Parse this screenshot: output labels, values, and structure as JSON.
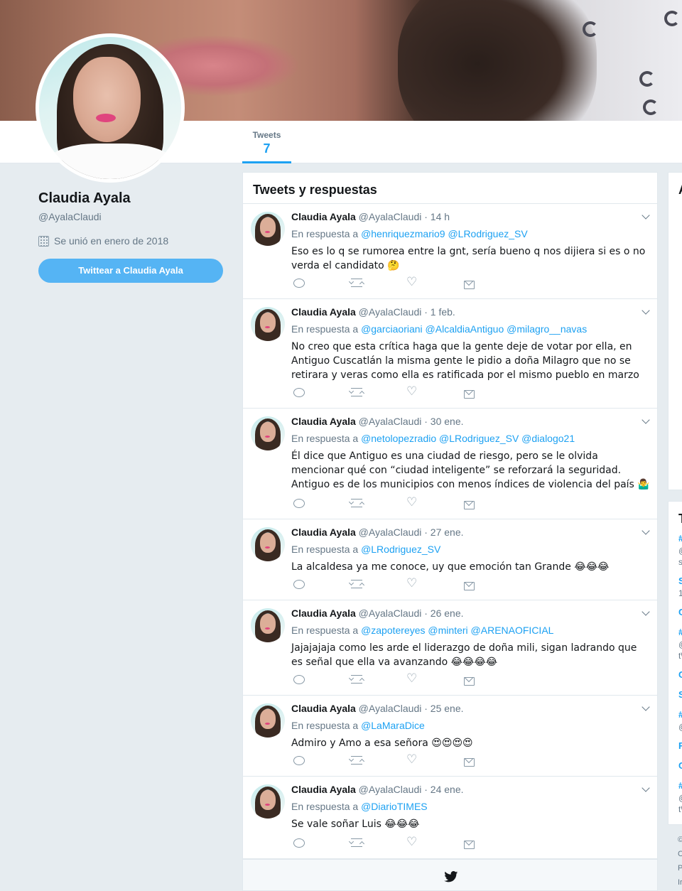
{
  "profile": {
    "name": "Claudia Ayala",
    "handle": "@AyalaClaudi",
    "joined": "Se unió en enero de 2018",
    "tweet_to_button": "Twittear a Claudia Ayala"
  },
  "nav": {
    "tweets_label": "Tweets",
    "tweets_count": "7"
  },
  "timeline": {
    "header": "Tweets y respuestas",
    "reply_prefix": "En respuesta a",
    "tweets": [
      {
        "name": "Claudia Ayala",
        "handle": "@AyalaClaudi",
        "time": "· 14 h",
        "mentions": "@henriquezmario9 @LRodriguez_SV",
        "text": "Eso es lo q se rumorea entre la gnt, sería bueno q nos dijiera si es o no verda el candidato 🤔"
      },
      {
        "name": "Claudia Ayala",
        "handle": "@AyalaClaudi",
        "time": "· 1 feb.",
        "mentions": "@garciaoriani @AlcaldiaAntiguo @milagro__navas",
        "text": "No creo que esta crítica haga que la gente deje de votar por ella, en Antiguo Cuscatlán la misma gente le pidio a doña Milagro que no se retirara y veras como ella es ratificada por el mismo pueblo en marzo"
      },
      {
        "name": "Claudia Ayala",
        "handle": "@AyalaClaudi",
        "time": "· 30 ene.",
        "mentions": "@netolopezradio @LRodriguez_SV @dialogo21",
        "text": "Él dice que Antiguo es una ciudad de riesgo, pero se le olvida mencionar qué con “ciudad inteligente” se reforzará la seguridad. Antiguo es de los municipios con menos índices de violencia del país 🤷‍♂️"
      },
      {
        "name": "Claudia Ayala",
        "handle": "@AyalaClaudi",
        "time": "· 27 ene.",
        "mentions": "@LRodriguez_SV",
        "text": "La alcaldesa ya me conoce, uy que emoción tan Grande 😂😂😂"
      },
      {
        "name": "Claudia Ayala",
        "handle": "@AyalaClaudi",
        "time": "· 26 ene.",
        "mentions": "@zapotereyes @minteri @ARENAOFICIAL",
        "text": "Jajajajaja como les arde el liderazgo de doña mili, sigan ladrando que es señal que ella va avanzando 😂😂😂😂"
      },
      {
        "name": "Claudia Ayala",
        "handle": "@AyalaClaudi",
        "time": "· 25 ene.",
        "mentions": "@LaMaraDice",
        "text": "Admiro y Amo a esa señora 😍😍😍😍"
      },
      {
        "name": "Claudia Ayala",
        "handle": "@AyalaClaudi",
        "time": "· 24 ene.",
        "mentions": "@DiarioTIMES",
        "text": "Se vale soñar Luis 😂😂😂"
      }
    ]
  },
  "right_col": {
    "frag_a": "A",
    "frag_t": "T",
    "frag_hash1": "#",
    "frag_at1": "@",
    "frag_s1": "s",
    "frag_S": "S",
    "frag_1": "1",
    "frag_C1": "C",
    "frag_hash2": "#",
    "frag_at2": "@",
    "frag_tw1": "t\\",
    "frag_C2": "C",
    "frag_S2": "S",
    "frag_hash3": "#",
    "frag_at3": "@",
    "frag_F": "F",
    "frag_C3": "C",
    "frag_hash4": "#",
    "frag_at4": "@",
    "frag_tw2": "t\\",
    "footer_copy": "©",
    "footer_c": "C",
    "footer_p": "P",
    "footer_i": "Ir"
  },
  "colors": {
    "accent": "#1da1f2",
    "button_bg": "#55b4f4",
    "page_bg": "#e6ecf0",
    "secondary_text": "#657786"
  }
}
